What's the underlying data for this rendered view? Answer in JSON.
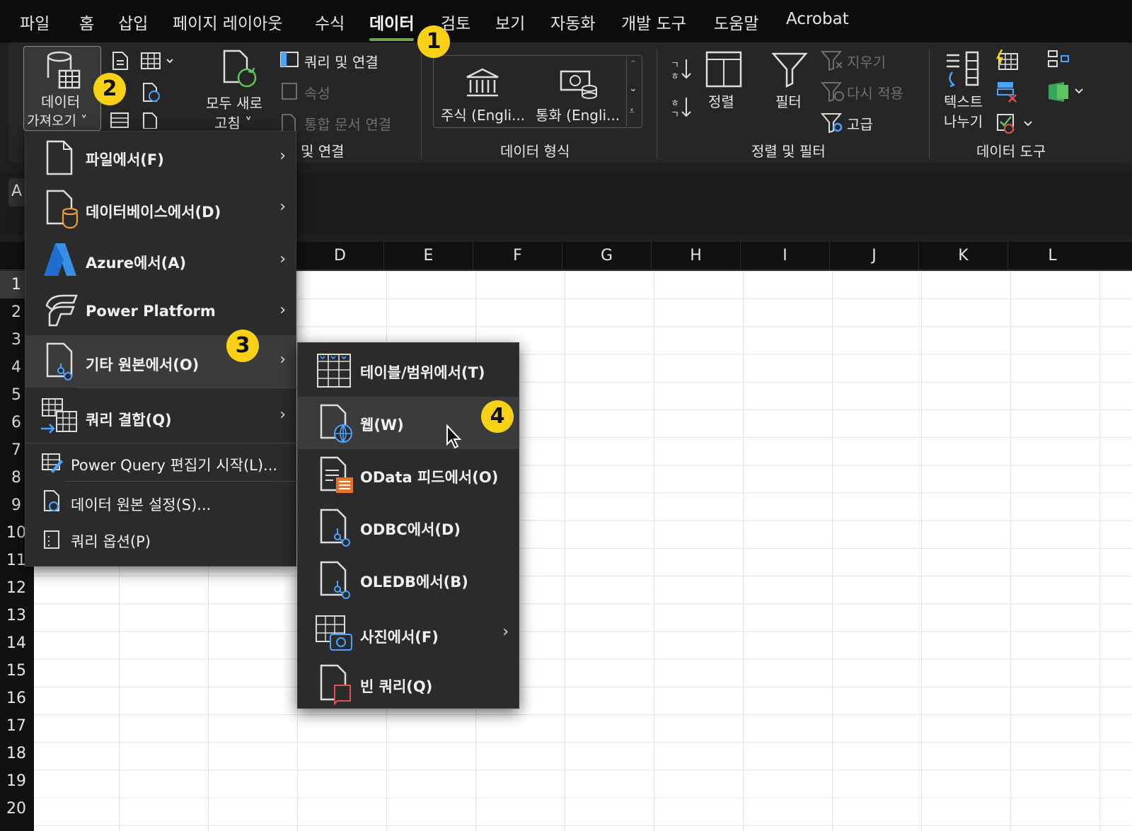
{
  "menu_tabs": [
    "파일",
    "홈",
    "삽입",
    "페이지 레이아웃",
    "수식",
    "데이터",
    "검토",
    "보기",
    "자동화",
    "개발 도구",
    "도움말",
    "Acrobat"
  ],
  "ribbon": {
    "get_data_line1": "데이터",
    "get_data_line2": "가져오기 ˅",
    "refresh_all_line1": "모두 새로",
    "refresh_all_line2": "고침 ˅",
    "queries_connections": "쿼리 및 연결",
    "properties": "속성",
    "edit_links": "통합 문서 연결",
    "group_queries": "및 연결",
    "stocks": "주식 (Engli...",
    "currencies": "통화 (Engli...",
    "group_datatypes": "데이터 형식",
    "sort": "정렬",
    "filter": "필터",
    "clear": "지우기",
    "reapply": "다시 적용",
    "advanced": "고급",
    "group_sortfilter": "정렬 및 필터",
    "text_to_columns_line1": "텍스트",
    "text_to_columns_line2": "나누기",
    "group_datatools": "데이터 도구"
  },
  "name_box": "A",
  "columns": [
    "D",
    "E",
    "F",
    "G",
    "H",
    "I",
    "J",
    "K",
    "L"
  ],
  "rows": [
    "1",
    "2",
    "3",
    "4",
    "5",
    "6",
    "7",
    "8",
    "9",
    "10",
    "11",
    "12",
    "13",
    "14",
    "15",
    "16",
    "17",
    "18",
    "19",
    "20"
  ],
  "main_menu": [
    {
      "label": "파일에서(F)"
    },
    {
      "label": "데이터베이스에서(D)"
    },
    {
      "label": "Azure에서(A)"
    },
    {
      "label": "Power Platform"
    },
    {
      "label": "기타 원본에서(O)"
    },
    {
      "label": "쿼리 결합(Q)"
    },
    {
      "label": "Power Query 편집기 시작(L)..."
    },
    {
      "label": "데이터 원본 설정(S)..."
    },
    {
      "label": "쿼리 옵션(P)"
    }
  ],
  "sub_menu": [
    {
      "label": "테이블/범위에서(T)"
    },
    {
      "label": "웹(W)"
    },
    {
      "label": "OData 피드에서(O)"
    },
    {
      "label": "ODBC에서(D)"
    },
    {
      "label": "OLEDB에서(B)"
    },
    {
      "label": "사진에서(F)"
    },
    {
      "label": "빈 쿼리(Q)"
    }
  ],
  "badges": [
    "1",
    "2",
    "3",
    "4"
  ],
  "colors": {
    "accent": "#6aa84f",
    "badge": "#f8d117",
    "azure": "#1f7ae0",
    "odata": "#e8722a"
  }
}
